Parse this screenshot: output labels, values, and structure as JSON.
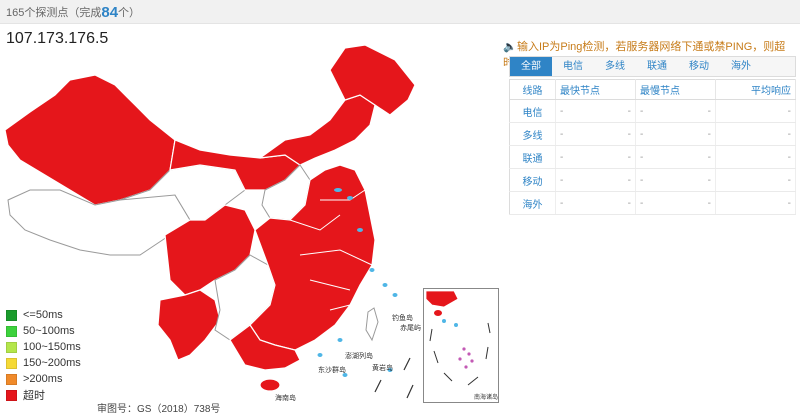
{
  "header": {
    "prefix": "165个探测点（完成",
    "completed": "84",
    "suffix": "个）"
  },
  "target_ip": "107.173.176.5",
  "notice": "输入IP为Ping检测，若服务器网络下通或禁PING，则超时。",
  "tabs": [
    {
      "label": "全部",
      "active": true
    },
    {
      "label": "电信",
      "active": false
    },
    {
      "label": "多线",
      "active": false
    },
    {
      "label": "联通",
      "active": false
    },
    {
      "label": "移动",
      "active": false
    },
    {
      "label": "海外",
      "active": false
    }
  ],
  "table": {
    "headers": {
      "line": "线路",
      "fastest": "最快节点",
      "slowest": "最慢节点",
      "avg": "平均响应"
    },
    "rows": [
      {
        "line": "电信",
        "fastest_a": "-",
        "fastest_b": "-",
        "slowest_a": "-",
        "slowest_b": "-",
        "avg": "-"
      },
      {
        "line": "多线",
        "fastest_a": "-",
        "fastest_b": "-",
        "slowest_a": "-",
        "slowest_b": "-",
        "avg": "-"
      },
      {
        "line": "联通",
        "fastest_a": "-",
        "fastest_b": "-",
        "slowest_a": "-",
        "slowest_b": "-",
        "avg": "-"
      },
      {
        "line": "移动",
        "fastest_a": "-",
        "fastest_b": "-",
        "slowest_a": "-",
        "slowest_b": "-",
        "avg": "-"
      },
      {
        "line": "海外",
        "fastest_a": "-",
        "fastest_b": "-",
        "slowest_a": "-",
        "slowest_b": "-",
        "avg": "-"
      }
    ]
  },
  "legend": [
    {
      "label": "<=50ms",
      "color": "#1a9b2c"
    },
    {
      "label": "50~100ms",
      "color": "#3cd23c"
    },
    {
      "label": "100~150ms",
      "color": "#b4e64b"
    },
    {
      "label": "150~200ms",
      "color": "#f5d936"
    },
    {
      "label": ">200ms",
      "color": "#f08a2a"
    },
    {
      "label": "超时",
      "color": "#e5161b"
    }
  ],
  "map_labels": {
    "island_1": "钓鱼岛",
    "island_2": "赤尾屿",
    "island_3": "澎湖列岛",
    "island_4": "黄岩岛",
    "island_5": "东沙群岛",
    "island_6": "海南岛"
  },
  "inset_caption": "南海诸岛",
  "approval_number": "审图号：GS（2018）738号",
  "colors": {
    "accent": "#2f84c6",
    "timeout": "#e5161b",
    "notice": "#c77c1a"
  }
}
